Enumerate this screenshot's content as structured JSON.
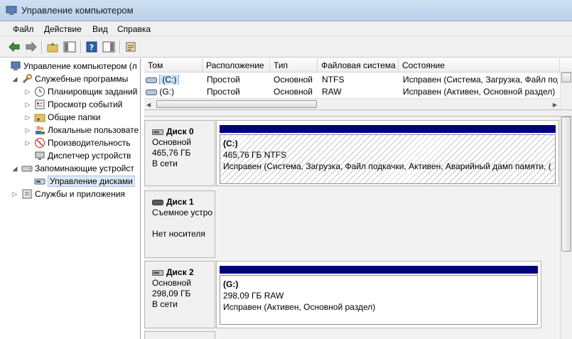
{
  "window": {
    "title": "Управление компьютером"
  },
  "menu": [
    "Файл",
    "Действие",
    "Вид",
    "Справка"
  ],
  "tree": {
    "root": "Управление компьютером (л",
    "items": [
      {
        "label": "Служебные программы",
        "level": 1,
        "icon": "tools-icon",
        "expanded": true
      },
      {
        "label": "Планировщик заданий",
        "level": 2,
        "icon": "clock-icon"
      },
      {
        "label": "Просмотр событий",
        "level": 2,
        "icon": "event-viewer-icon"
      },
      {
        "label": "Общие папки",
        "level": 2,
        "icon": "shared-folder-icon"
      },
      {
        "label": "Локальные пользовате",
        "level": 2,
        "icon": "users-icon"
      },
      {
        "label": "Производительность",
        "level": 2,
        "icon": "performance-icon"
      },
      {
        "label": "Диспетчер устройств",
        "level": 2,
        "icon": "device-manager-icon"
      },
      {
        "label": "Запоминающие устройст",
        "level": 1,
        "icon": "storage-icon",
        "expanded": true
      },
      {
        "label": "Управление дисками",
        "level": 2,
        "icon": "disk-management-icon",
        "selected": true
      },
      {
        "label": "Службы и приложения",
        "level": 1,
        "icon": "services-icon"
      }
    ]
  },
  "volumes": {
    "columns": [
      "Том",
      "Расположение",
      "Тип",
      "Файловая система",
      "Состояние"
    ],
    "rows": [
      {
        "name": "(C:)",
        "layout": "Простой",
        "type": "Основной",
        "fs": "NTFS",
        "status": "Исправен (Система, Загрузка, Файл подк"
      },
      {
        "name": "(G:)",
        "layout": "Простой",
        "type": "Основной",
        "fs": "RAW",
        "status": "Исправен (Активен, Основной раздел)"
      }
    ]
  },
  "disks": [
    {
      "name": "Диск 0",
      "type": "Основной",
      "size": "465,76 ГБ",
      "state": "В сети",
      "partition": {
        "letter": "(C:)",
        "size_fs": "465,76 ГБ NTFS",
        "status": "Исправен (Система, Загрузка, Файл подкачки, Активен, Аварийный дамп памяти, ("
      }
    },
    {
      "name": "Диск 1",
      "type": "Съемное устро",
      "size": "",
      "state": "Нет носителя"
    },
    {
      "name": "Диск 2",
      "type": "Основной",
      "size": "298,09 ГБ",
      "state": "В сети",
      "partition": {
        "letter": "(G:)",
        "size_fs": "298,09 ГБ RAW",
        "status": "Исправен (Активен, Основной раздел)"
      }
    }
  ],
  "colors": {
    "partition_bar": "#000080",
    "selection": "#cfe3fb"
  }
}
